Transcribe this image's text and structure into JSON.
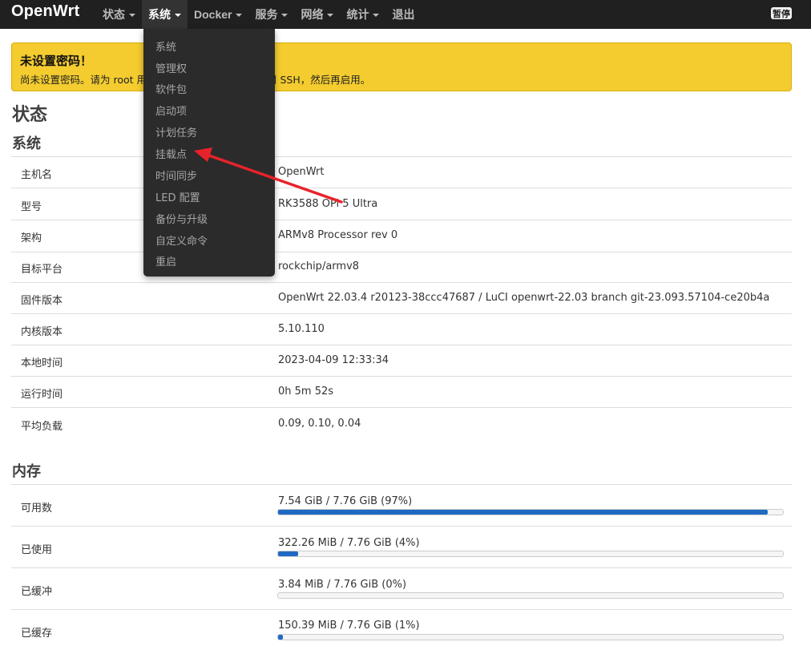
{
  "navbar": {
    "brand": "OpenWrt",
    "items": [
      {
        "label": "状态",
        "dropdown": true
      },
      {
        "label": "系统",
        "dropdown": true,
        "active": true
      },
      {
        "label": "Docker",
        "dropdown": true
      },
      {
        "label": "服务",
        "dropdown": true
      },
      {
        "label": "网络",
        "dropdown": true
      },
      {
        "label": "统计",
        "dropdown": true
      },
      {
        "label": "退出",
        "dropdown": false
      }
    ],
    "pause_label": "暂停"
  },
  "dropdown": {
    "items": [
      "系统",
      "管理权",
      "软件包",
      "启动项",
      "计划任务",
      "挂载点",
      "时间同步",
      "LED 配置",
      "备份与升级",
      "自定义命令",
      "重启"
    ]
  },
  "alert": {
    "title": "未设置密码！",
    "text": "尚未设置密码。请为 root 用户设置密码以保护主机并启用 SSH，然后再启用。"
  },
  "page": {
    "title": "状态"
  },
  "system": {
    "heading": "系统",
    "rows": [
      {
        "label": "主机名",
        "value": "OpenWrt"
      },
      {
        "label": "型号",
        "value": "RK3588 OPi 5 Ultra"
      },
      {
        "label": "架构",
        "value": "ARMv8 Processor rev 0"
      },
      {
        "label": "目标平台",
        "value": "rockchip/armv8"
      },
      {
        "label": "固件版本",
        "value": "OpenWrt 22.03.4 r20123-38ccc47687 / LuCI openwrt-22.03 branch git-23.093.57104-ce20b4a"
      },
      {
        "label": "内核版本",
        "value": "5.10.110"
      },
      {
        "label": "本地时间",
        "value": "2023-04-09 12:33:34"
      },
      {
        "label": "运行时间",
        "value": "0h 5m 52s"
      },
      {
        "label": "平均负载",
        "value": "0.09, 0.10, 0.04"
      }
    ]
  },
  "memory": {
    "heading": "内存",
    "rows": [
      {
        "label": "可用数",
        "value": "7.54 GiB / 7.76 GiB (97%)",
        "percent": 97
      },
      {
        "label": "已使用",
        "value": "322.26 MiB / 7.76 GiB (4%)",
        "percent": 4
      },
      {
        "label": "已缓冲",
        "value": "3.84 MiB / 7.76 GiB (0%)",
        "percent": 0
      },
      {
        "label": "已缓存",
        "value": "150.39 MiB / 7.76 GiB (1%)",
        "percent": 1
      }
    ]
  },
  "colors": {
    "navbar_bg": "#202020",
    "alert_bg": "#f4cc2f",
    "bar_fill": "#1f6ac3",
    "arrow": "#e8222a"
  }
}
